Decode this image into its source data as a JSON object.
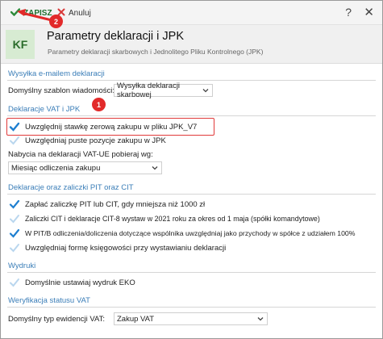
{
  "toolbar": {
    "save_label": "ZAPISZ",
    "cancel_label": "Anuluj",
    "help_label": "?",
    "close_label": "✕"
  },
  "header": {
    "logo_text": "KF",
    "title": "Parametry deklaracji i JPK",
    "subtitle": "Parametry deklaracji skarbowych i Jednolitego Pliku Kontrolnego (JPK)"
  },
  "sections": {
    "email": {
      "title": "Wysyłka e-mailem deklaracji",
      "template_label": "Domyślny szablon wiadomości:",
      "template_value": "Wysyłka deklaracji skarbowej"
    },
    "vat": {
      "title": "Deklaracje VAT i JPK",
      "zero_rate": "Uwzględnij stawkę zerową zakupu w pliku JPK_V7",
      "empty_positions": "Uwzględniaj puste pozycje zakupu w JPK",
      "vatue_label": "Nabycia na deklaracji VAT-UE pobieraj wg:",
      "vatue_value": "Miesiąc odliczenia zakupu"
    },
    "pit": {
      "title": "Deklaracje oraz zaliczki PIT oraz CIT",
      "item1": "Zapłać zaliczkę PIT lub CIT, gdy mniejsza niż 1000 zł",
      "item2": "Zaliczki CIT i deklaracje CIT-8 wystaw w 2021 roku za okres od 1 maja (spółki komandytowe)",
      "item3": "W PIT/B odliczenia/doliczenia dotyczące wspólnika uwzględniaj jako przychody w spółce z udziałem 100%",
      "item4": "Uwzględniaj formę księgowości przy wystawianiu deklaracji"
    },
    "prints": {
      "title": "Wydruki",
      "eko": "Domyślnie ustawiaj wydruk EKO"
    },
    "verify": {
      "title": "Weryfikacja statusu VAT",
      "type_label": "Domyślny typ ewidencji VAT:",
      "type_value": "Zakup VAT"
    }
  },
  "annotations": {
    "badge1": "1",
    "badge2": "2"
  },
  "colors": {
    "accent_blue": "#3b7eb8",
    "check_blue": "#1e7fd0",
    "check_light": "#b9d6ee",
    "annotation_red": "#e22a2a",
    "save_green": "#1e6f2e"
  }
}
